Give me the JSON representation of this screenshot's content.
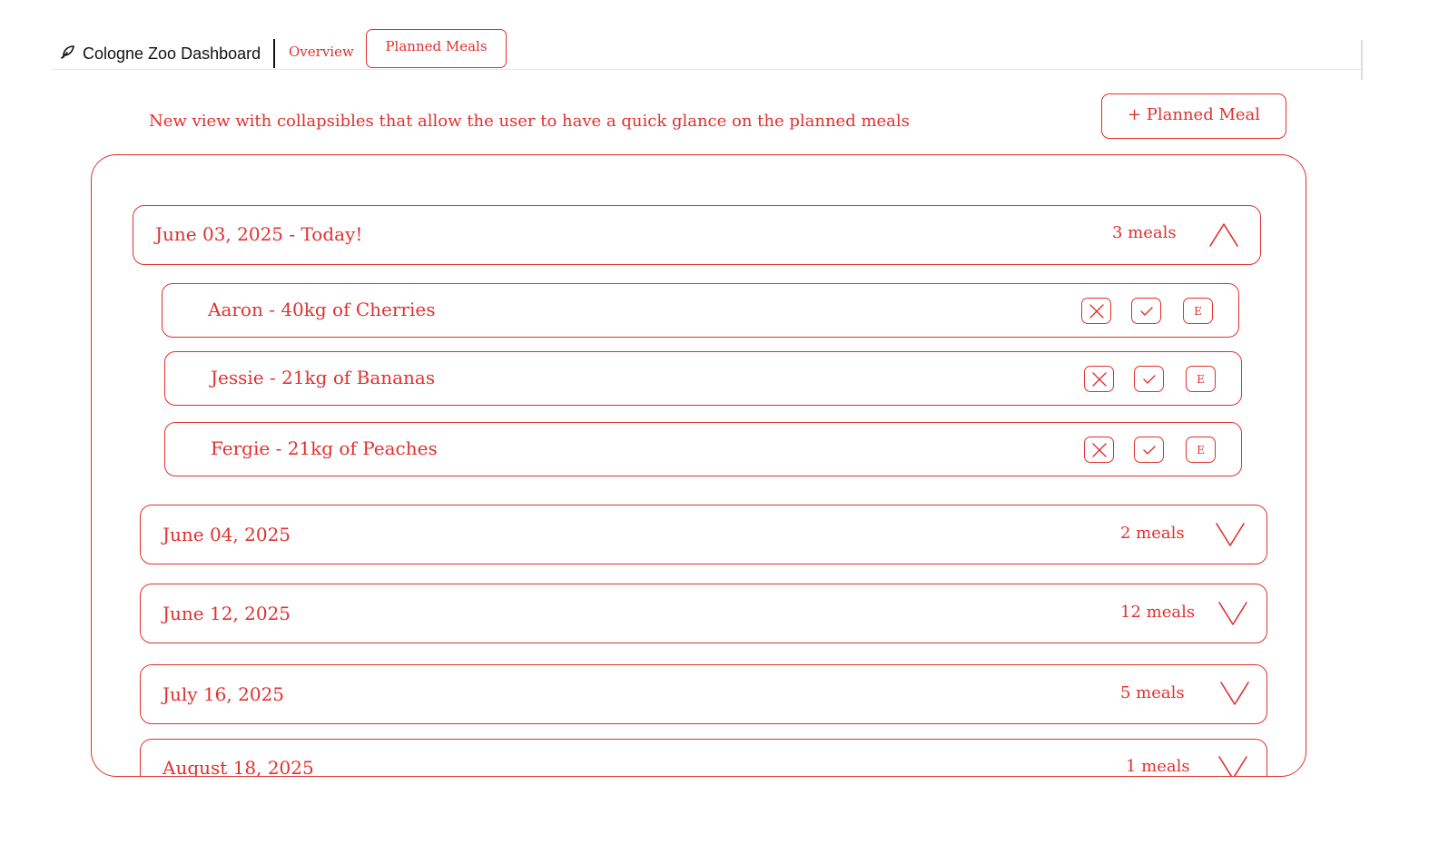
{
  "header": {
    "app_title": "Cologne Zoo Dashboard",
    "brand_icon": "feather-icon",
    "tabs": [
      {
        "label": "Overview",
        "active": false
      },
      {
        "label": "Planned Meals",
        "active": true
      }
    ]
  },
  "annotation": "New view with collapsibles that allow the user to have a quick glance on the planned meals",
  "add_button_label": "+ Planned Meal",
  "days": [
    {
      "date": "June 03, 2025 - Today!",
      "count": "3 meals",
      "expanded": true,
      "meals": [
        {
          "label": "Aaron - 40kg of Cherries"
        },
        {
          "label": "Jessie - 21kg of Bananas"
        },
        {
          "label": "Fergie - 21kg of Peaches"
        }
      ]
    },
    {
      "date": "June 04, 2025",
      "count": "2 meals",
      "expanded": false
    },
    {
      "date": "June 12, 2025",
      "count": "12 meals",
      "expanded": false
    },
    {
      "date": "July 16, 2025",
      "count": "5 meals",
      "expanded": false
    },
    {
      "date": "August 18, 2025",
      "count": "1 meals",
      "expanded": false
    }
  ],
  "meal_actions": {
    "delete_icon": "x-icon",
    "confirm_icon": "check-icon",
    "edit_label": "E"
  },
  "colors": {
    "accent": "#e0312f",
    "text_dark": "#111111",
    "divider": "#e6e6e6"
  }
}
